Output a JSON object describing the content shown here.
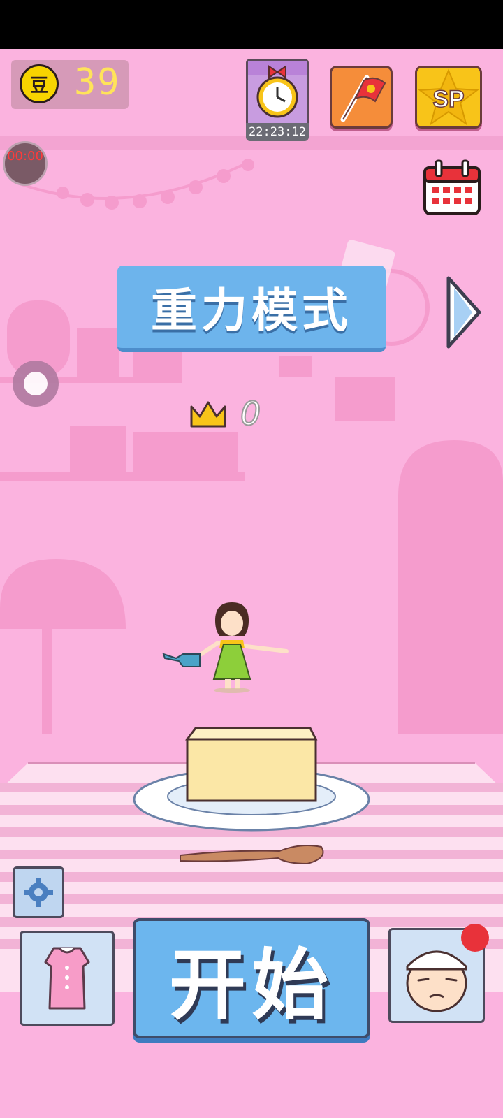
{
  "hud": {
    "coins": "39",
    "coin_symbol": "豆",
    "timer_text": "00:00",
    "countdown": "22:23:12",
    "sp_label": "SP"
  },
  "mode": {
    "title": "重力模式",
    "best_score": "0"
  },
  "actions": {
    "start_label": "开始"
  },
  "colors": {
    "background": "#fbb3df",
    "accent_blue": "#6db4ec",
    "coin_gold": "#f7d400",
    "notification_red": "#e8323a"
  },
  "icons": [
    "coin-icon",
    "alarm-clock-icon",
    "flag-icon",
    "sp-star-icon",
    "calendar-icon",
    "next-arrow-icon",
    "crown-icon",
    "gear-icon",
    "dress-icon",
    "chef-icon"
  ]
}
